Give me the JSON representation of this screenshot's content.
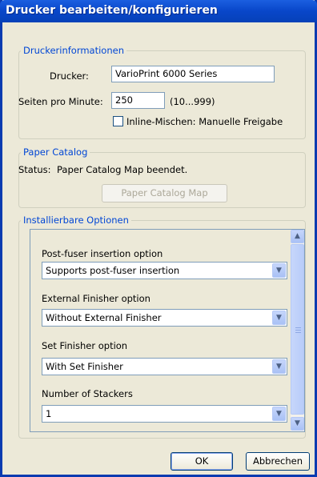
{
  "window": {
    "title": "Drucker bearbeiten/konfigurieren"
  },
  "printer_info": {
    "legend": "Druckerinformationen",
    "printer_label": "Drucker:",
    "printer_value": "VarioPrint 6000 Series",
    "ppm_label": "Seiten pro Minute:",
    "ppm_value": "250",
    "ppm_range": "(10...999)",
    "inline_mixing_label": "Inline-Mischen: Manuelle Freigabe",
    "inline_mixing_checked": false
  },
  "paper_catalog": {
    "legend": "Paper Catalog",
    "status_label": "Status:",
    "status_value": "Paper Catalog Map beendet.",
    "map_button": "Paper Catalog Map"
  },
  "installable_options": {
    "legend": "Installierbare Optionen",
    "options": [
      {
        "label": "Post-fuser insertion option",
        "value": "Supports post-fuser insertion"
      },
      {
        "label": "External Finisher option",
        "value": "Without External Finisher"
      },
      {
        "label": "Set Finisher option",
        "value": "With Set Finisher"
      },
      {
        "label": "Number of Stackers",
        "value": "1"
      }
    ]
  },
  "buttons": {
    "ok": "OK",
    "cancel": "Abbrechen"
  },
  "icons": {
    "chevron": "chevron-down-icon",
    "scroll_up": "chevron-up-icon"
  },
  "colors": {
    "title_bar": "#0846c9",
    "legend": "#0046d5",
    "dialog_bg": "#ece9d8"
  }
}
